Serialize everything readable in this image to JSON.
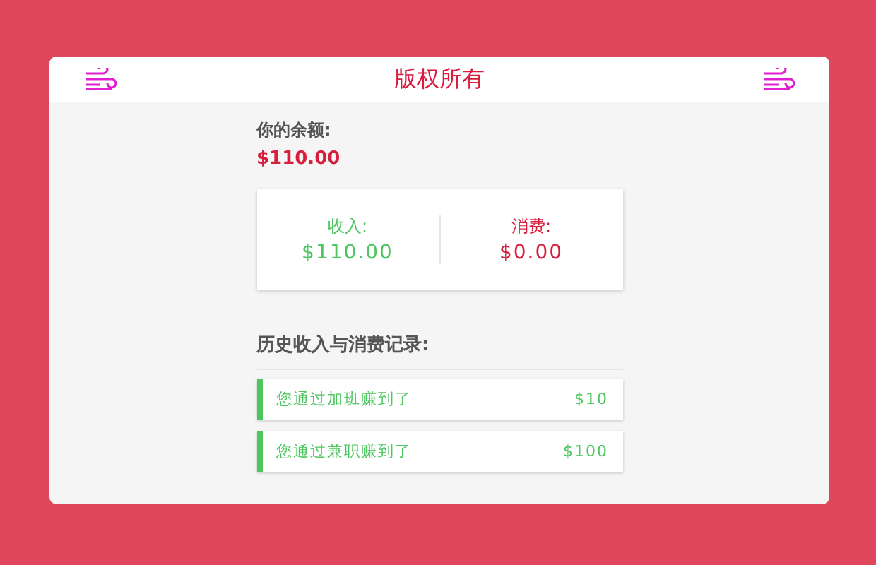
{
  "header": {
    "title": "版权所有"
  },
  "balance": {
    "label": "你的余额:",
    "amount": "$110.00"
  },
  "summary": [
    {
      "kind": "income",
      "label": "收入:",
      "amount": "$110.00"
    },
    {
      "kind": "expense",
      "label": "消费:",
      "amount": "$0.00"
    }
  ],
  "history": {
    "title": "历史收入与消费记录:",
    "records": [
      {
        "kind": "income",
        "text": "您通过加班赚到了",
        "amount": "$10"
      },
      {
        "kind": "income",
        "text": "您通过兼职赚到了",
        "amount": "$100"
      }
    ]
  }
}
